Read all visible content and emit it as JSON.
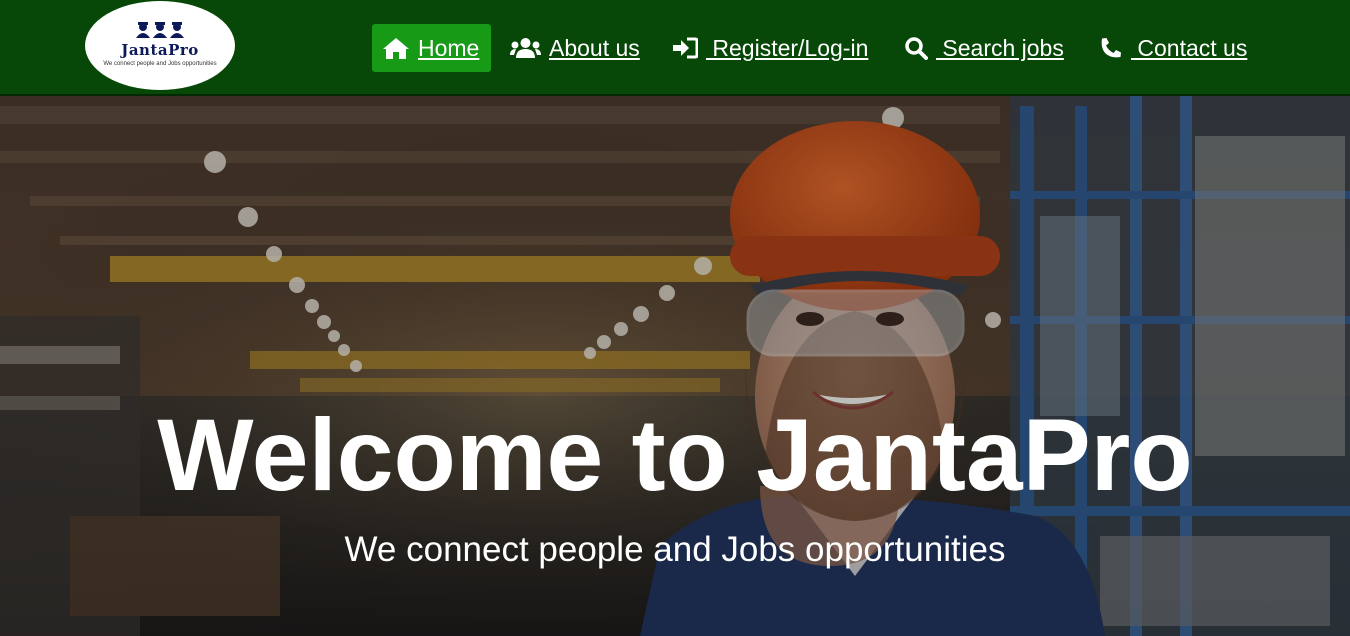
{
  "brand": {
    "name": "JantaPro",
    "tagline": "We connect people and Jobs opportunities"
  },
  "nav": {
    "items": [
      {
        "label": "Home",
        "icon": "home-icon",
        "active": true
      },
      {
        "label": "About us",
        "icon": "users-icon",
        "active": false
      },
      {
        "label": " Register/Log-in",
        "icon": "sign-in-icon",
        "active": false
      },
      {
        "label": " Search jobs",
        "icon": "search-icon",
        "active": false
      },
      {
        "label": " Contact us",
        "icon": "phone-icon",
        "active": false
      }
    ]
  },
  "hero": {
    "title": "Welcome to JantaPro",
    "subtitle": "We connect people and Jobs opportunities"
  },
  "colors": {
    "header_bg": "#074707",
    "active_nav_bg": "#179b17",
    "text": "#ffffff"
  }
}
